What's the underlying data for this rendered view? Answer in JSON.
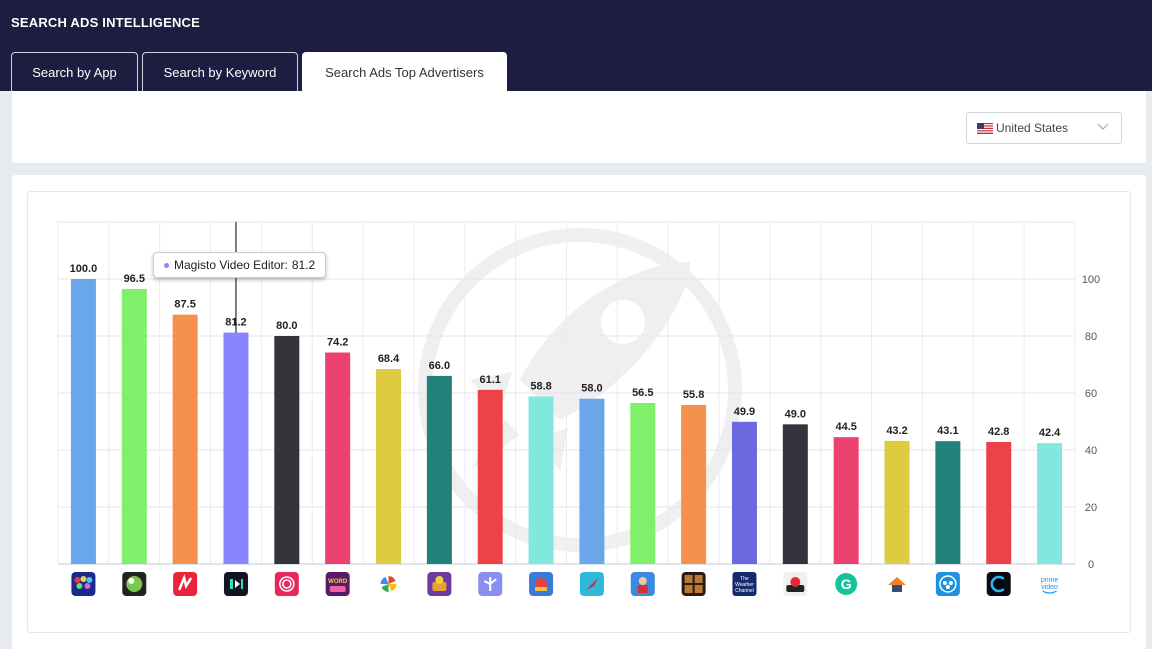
{
  "header": {
    "title": "SEARCH ADS INTELLIGENCE"
  },
  "tabs": [
    {
      "label": "Search by App",
      "active": false
    },
    {
      "label": "Search by Keyword",
      "active": false
    },
    {
      "label": "Search Ads Top Advertisers",
      "active": true
    }
  ],
  "filter": {
    "country": "United States",
    "flag_icon": "us-flag-icon"
  },
  "tooltip": {
    "name": "Magisto Video Editor:",
    "value": "81.2",
    "color": "#8886ff"
  },
  "chart_data": {
    "type": "bar",
    "title": "",
    "xlabel": "",
    "ylabel": "",
    "ylim": [
      0,
      120
    ],
    "yticks": [
      0,
      20,
      40,
      60,
      80,
      100
    ],
    "y_axis_position": "right",
    "grid": true,
    "legend": "none",
    "values": [
      100.0,
      96.5,
      87.5,
      81.2,
      80.0,
      74.2,
      68.4,
      66.0,
      61.1,
      58.8,
      58.0,
      56.5,
      55.8,
      49.9,
      49.0,
      44.5,
      43.2,
      43.1,
      42.8,
      42.4
    ],
    "value_labels": [
      "100.0",
      "96.5",
      "87.5",
      "81.2",
      "80.0",
      "74.2",
      "68.4",
      "66.0",
      "61.1",
      "58.8",
      "58.0",
      "56.5",
      "55.8",
      "49.9",
      "49.0",
      "44.5",
      "43.2",
      "43.1",
      "42.8",
      "42.4"
    ],
    "colors": [
      "#6aa6ea",
      "#80ef6a",
      "#f6914d",
      "#8886ff",
      "#34343c",
      "#ec4270",
      "#dfcb40",
      "#228178",
      "#ed4248",
      "#80e8dc",
      "#6aa6ea",
      "#80ef6a",
      "#f6914d",
      "#6c68e0",
      "#34343c",
      "#ec4270",
      "#dfcb40",
      "#228178",
      "#ed4248",
      "#80e8dc"
    ],
    "category_icons": [
      "bubble-shooter-app-icon",
      "pool-game-app-icon",
      "news-app-icon",
      "magisto-app-icon",
      "dating-app-icon",
      "word-game-app-icon",
      "photos-app-icon",
      "treasure-game-app-icon",
      "travel-app-icon",
      "strategy-game-app-icon",
      "fishing-app-icon",
      "hero-game-app-icon",
      "puzzle-app-icon",
      "weather-channel-app-icon",
      "sushi-app-icon",
      "grammarly-app-icon",
      "home-app-icon",
      "people-app-icon",
      "c-app-icon",
      "prime-video-app-icon"
    ],
    "icon_texts": {
      "word_game": "WORD",
      "weather": [
        "The",
        "Weather",
        "Channel"
      ],
      "prime": [
        "prime",
        "video"
      ]
    }
  }
}
